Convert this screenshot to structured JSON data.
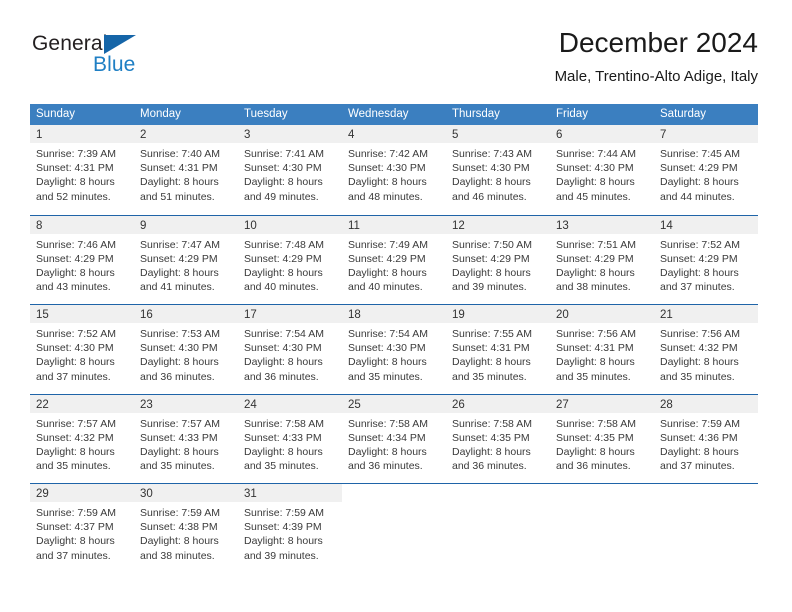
{
  "brand": {
    "word1": "General",
    "word2": "Blue",
    "triangle_color": "#1565a8",
    "blue_color": "#1f7fc4"
  },
  "header": {
    "title": "December 2024",
    "subtitle": "Male, Trentino-Alto Adige, Italy"
  },
  "theme": {
    "header_blue": "#3b7fc0",
    "row_rule_blue": "#1f64a8",
    "day_band_gray": "#f0f0f0"
  },
  "calendar": {
    "day_headers": [
      "Sunday",
      "Monday",
      "Tuesday",
      "Wednesday",
      "Thursday",
      "Friday",
      "Saturday"
    ],
    "weeks": [
      [
        {
          "day": "1",
          "lines": [
            "Sunrise: 7:39 AM",
            "Sunset: 4:31 PM",
            "Daylight: 8 hours",
            "and 52 minutes."
          ]
        },
        {
          "day": "2",
          "lines": [
            "Sunrise: 7:40 AM",
            "Sunset: 4:31 PM",
            "Daylight: 8 hours",
            "and 51 minutes."
          ]
        },
        {
          "day": "3",
          "lines": [
            "Sunrise: 7:41 AM",
            "Sunset: 4:30 PM",
            "Daylight: 8 hours",
            "and 49 minutes."
          ]
        },
        {
          "day": "4",
          "lines": [
            "Sunrise: 7:42 AM",
            "Sunset: 4:30 PM",
            "Daylight: 8 hours",
            "and 48 minutes."
          ]
        },
        {
          "day": "5",
          "lines": [
            "Sunrise: 7:43 AM",
            "Sunset: 4:30 PM",
            "Daylight: 8 hours",
            "and 46 minutes."
          ]
        },
        {
          "day": "6",
          "lines": [
            "Sunrise: 7:44 AM",
            "Sunset: 4:30 PM",
            "Daylight: 8 hours",
            "and 45 minutes."
          ]
        },
        {
          "day": "7",
          "lines": [
            "Sunrise: 7:45 AM",
            "Sunset: 4:29 PM",
            "Daylight: 8 hours",
            "and 44 minutes."
          ]
        }
      ],
      [
        {
          "day": "8",
          "lines": [
            "Sunrise: 7:46 AM",
            "Sunset: 4:29 PM",
            "Daylight: 8 hours",
            "and 43 minutes."
          ]
        },
        {
          "day": "9",
          "lines": [
            "Sunrise: 7:47 AM",
            "Sunset: 4:29 PM",
            "Daylight: 8 hours",
            "and 41 minutes."
          ]
        },
        {
          "day": "10",
          "lines": [
            "Sunrise: 7:48 AM",
            "Sunset: 4:29 PM",
            "Daylight: 8 hours",
            "and 40 minutes."
          ]
        },
        {
          "day": "11",
          "lines": [
            "Sunrise: 7:49 AM",
            "Sunset: 4:29 PM",
            "Daylight: 8 hours",
            "and 40 minutes."
          ]
        },
        {
          "day": "12",
          "lines": [
            "Sunrise: 7:50 AM",
            "Sunset: 4:29 PM",
            "Daylight: 8 hours",
            "and 39 minutes."
          ]
        },
        {
          "day": "13",
          "lines": [
            "Sunrise: 7:51 AM",
            "Sunset: 4:29 PM",
            "Daylight: 8 hours",
            "and 38 minutes."
          ]
        },
        {
          "day": "14",
          "lines": [
            "Sunrise: 7:52 AM",
            "Sunset: 4:29 PM",
            "Daylight: 8 hours",
            "and 37 minutes."
          ]
        }
      ],
      [
        {
          "day": "15",
          "lines": [
            "Sunrise: 7:52 AM",
            "Sunset: 4:30 PM",
            "Daylight: 8 hours",
            "and 37 minutes."
          ]
        },
        {
          "day": "16",
          "lines": [
            "Sunrise: 7:53 AM",
            "Sunset: 4:30 PM",
            "Daylight: 8 hours",
            "and 36 minutes."
          ]
        },
        {
          "day": "17",
          "lines": [
            "Sunrise: 7:54 AM",
            "Sunset: 4:30 PM",
            "Daylight: 8 hours",
            "and 36 minutes."
          ]
        },
        {
          "day": "18",
          "lines": [
            "Sunrise: 7:54 AM",
            "Sunset: 4:30 PM",
            "Daylight: 8 hours",
            "and 35 minutes."
          ]
        },
        {
          "day": "19",
          "lines": [
            "Sunrise: 7:55 AM",
            "Sunset: 4:31 PM",
            "Daylight: 8 hours",
            "and 35 minutes."
          ]
        },
        {
          "day": "20",
          "lines": [
            "Sunrise: 7:56 AM",
            "Sunset: 4:31 PM",
            "Daylight: 8 hours",
            "and 35 minutes."
          ]
        },
        {
          "day": "21",
          "lines": [
            "Sunrise: 7:56 AM",
            "Sunset: 4:32 PM",
            "Daylight: 8 hours",
            "and 35 minutes."
          ]
        }
      ],
      [
        {
          "day": "22",
          "lines": [
            "Sunrise: 7:57 AM",
            "Sunset: 4:32 PM",
            "Daylight: 8 hours",
            "and 35 minutes."
          ]
        },
        {
          "day": "23",
          "lines": [
            "Sunrise: 7:57 AM",
            "Sunset: 4:33 PM",
            "Daylight: 8 hours",
            "and 35 minutes."
          ]
        },
        {
          "day": "24",
          "lines": [
            "Sunrise: 7:58 AM",
            "Sunset: 4:33 PM",
            "Daylight: 8 hours",
            "and 35 minutes."
          ]
        },
        {
          "day": "25",
          "lines": [
            "Sunrise: 7:58 AM",
            "Sunset: 4:34 PM",
            "Daylight: 8 hours",
            "and 36 minutes."
          ]
        },
        {
          "day": "26",
          "lines": [
            "Sunrise: 7:58 AM",
            "Sunset: 4:35 PM",
            "Daylight: 8 hours",
            "and 36 minutes."
          ]
        },
        {
          "day": "27",
          "lines": [
            "Sunrise: 7:58 AM",
            "Sunset: 4:35 PM",
            "Daylight: 8 hours",
            "and 36 minutes."
          ]
        },
        {
          "day": "28",
          "lines": [
            "Sunrise: 7:59 AM",
            "Sunset: 4:36 PM",
            "Daylight: 8 hours",
            "and 37 minutes."
          ]
        }
      ],
      [
        {
          "day": "29",
          "lines": [
            "Sunrise: 7:59 AM",
            "Sunset: 4:37 PM",
            "Daylight: 8 hours",
            "and 37 minutes."
          ]
        },
        {
          "day": "30",
          "lines": [
            "Sunrise: 7:59 AM",
            "Sunset: 4:38 PM",
            "Daylight: 8 hours",
            "and 38 minutes."
          ]
        },
        {
          "day": "31",
          "lines": [
            "Sunrise: 7:59 AM",
            "Sunset: 4:39 PM",
            "Daylight: 8 hours",
            "and 39 minutes."
          ]
        },
        {
          "day": "",
          "lines": []
        },
        {
          "day": "",
          "lines": []
        },
        {
          "day": "",
          "lines": []
        },
        {
          "day": "",
          "lines": []
        }
      ]
    ]
  }
}
